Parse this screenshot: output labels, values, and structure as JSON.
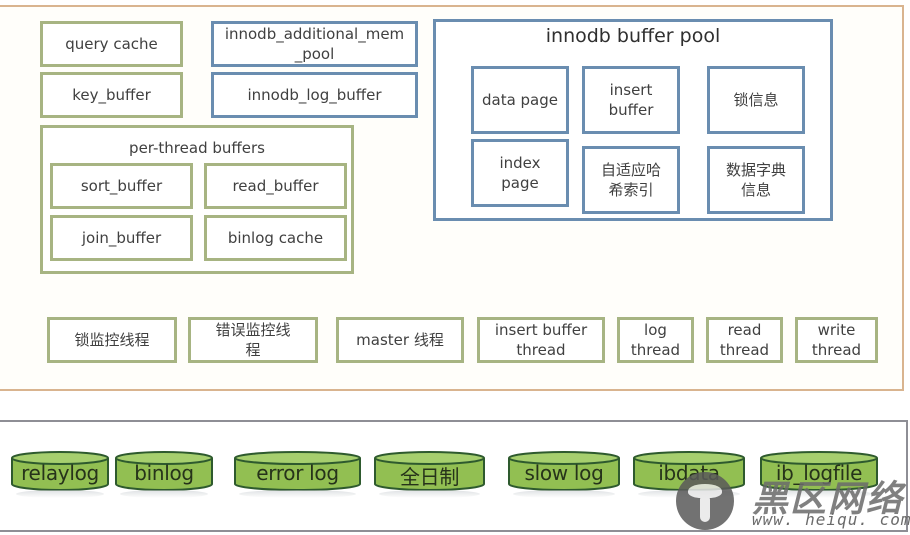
{
  "colors": {
    "top_panel_border": "#d9b48f",
    "bottom_panel_border": "#8e8e95",
    "green_box_border": "#a7b482",
    "blue_box_border": "#6a8db0",
    "cylinder_fill": "#92bf52",
    "cylinder_stroke": "#2e5a2e"
  },
  "memory": {
    "query_cache": "query cache",
    "key_buffer": "key_buffer",
    "innodb_additional_mem_pool": "innodb_additional_mem\n_pool",
    "innodb_log_buffer": "innodb_log_buffer",
    "per_thread": {
      "title": "per-thread buffers",
      "items": [
        "sort_buffer",
        "read_buffer",
        "join_buffer",
        "binlog cache"
      ]
    },
    "buffer_pool": {
      "title": "innodb buffer pool",
      "items": [
        "data page",
        "insert\nbuffer",
        "锁信息",
        "index\npage",
        "自适应哈\n希索引",
        "数据字典\n信息"
      ]
    }
  },
  "threads": [
    "锁监控线程",
    "错误监控线\n程",
    "master 线程",
    "insert buffer\nthread",
    "log\nthread",
    "read\nthread",
    "write\nthread"
  ],
  "files": [
    "relaylog",
    "binlog",
    "error log",
    "全日制",
    "slow log",
    "ibdata",
    "ib_logfile"
  ],
  "watermark": {
    "text": "黑区网络",
    "url": "www. heiqu. com"
  }
}
